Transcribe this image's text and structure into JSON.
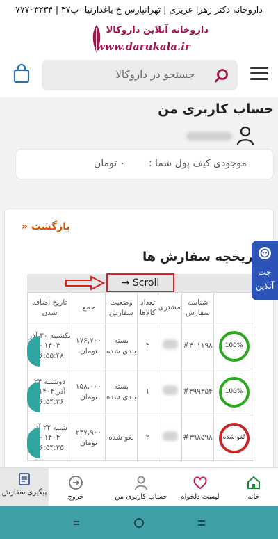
{
  "header": {
    "address": "داروخانه دکتر زهرا عزیزی | تهرانپارس-خ باغدارنیا- پ۳۷ | ۷۷۷۰۳۲۳۴",
    "logo_title": "داروخانه آنلاین داروکالا",
    "logo_url": "www.darukala.ir",
    "search_placeholder": "جستجو در داروکالا"
  },
  "account": {
    "title": "حساب کاربری من",
    "wallet_label": "موجودی کیف پول شما :",
    "wallet_value": "۰ تومان"
  },
  "orders_card": {
    "back_label": "بازگشت",
    "title": "تاریخچه سفارش ها",
    "scroll_hint": "→ Scroll",
    "columns": [
      "شناسه سفارش",
      "مشتری",
      "تعداد کالاها",
      "وضعیت سفارش",
      "جمع",
      "تاریخ اضافه شدن"
    ],
    "rows": [
      {
        "status_ring": "100%",
        "ring_color": "#2ca81e",
        "id": "#۴۰۱۱۹۸",
        "qty": "۳",
        "status": "بسته بندی شده",
        "total": "۱۷۶,۷۰۰ تومان",
        "date": "یکشنبه ۳۰ آذر ۱۴۰۴ - ۱۶:۵۵:۴۸"
      },
      {
        "status_ring": "100%",
        "ring_color": "#2ca81e",
        "id": "#۳۹۹۳۵۴",
        "qty": "۱",
        "status": "بسته بندی شده",
        "total": "۱۵۸,۰۰۰ تومان",
        "date": "دوشنبه ۲۴ آذر ۱۴۰۴ - ۱۶:۵۴:۲۶"
      },
      {
        "status_ring": "لغو شده",
        "ring_color": "#c62828",
        "id": "#۳۹۸۵۹۸",
        "qty": "۲",
        "status": "لغو شده",
        "total": "۲۴۷,۹۰۰ تومان",
        "date": "شنبه ۲۲ آذر ۱۴۰۴ - ۱۶:۵۴:۲۵"
      }
    ]
  },
  "chat": {
    "line1": "چت",
    "line2": "آنلاین"
  },
  "bottom_nav": [
    {
      "label": "خانه",
      "icon": "home-icon"
    },
    {
      "label": "لیست دلخواه",
      "icon": "heart-icon"
    },
    {
      "label": "حساب کاربری من",
      "icon": "user-icon"
    },
    {
      "label": "خروج",
      "icon": "logout-icon"
    },
    {
      "label": "پیگیری سفارش",
      "icon": "order-tracking-icon"
    }
  ],
  "colors": {
    "brand": "#a3124e",
    "accent_orange": "#d35400",
    "chat_blue": "#2b53b8",
    "system_bar": "#3f9fa6",
    "complete_green": "#2ca81e",
    "cancel_red": "#c62828"
  }
}
